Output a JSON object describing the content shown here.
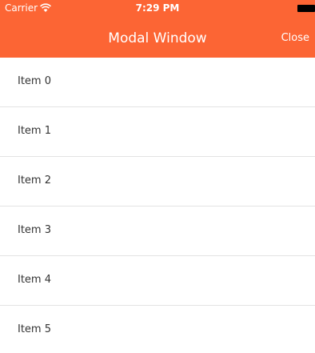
{
  "status_bar": {
    "carrier": "Carrier",
    "time": "7:29 PM"
  },
  "nav": {
    "title": "Modal Window",
    "close_label": "Close"
  },
  "list": {
    "items": [
      {
        "label": "Item 0"
      },
      {
        "label": "Item 1"
      },
      {
        "label": "Item 2"
      },
      {
        "label": "Item 3"
      },
      {
        "label": "Item 4"
      },
      {
        "label": "Item 5"
      }
    ]
  },
  "colors": {
    "header_bg": "#fc6534",
    "header_text": "#ffffff",
    "divider": "#e3e3e3",
    "item_text": "#333333"
  }
}
